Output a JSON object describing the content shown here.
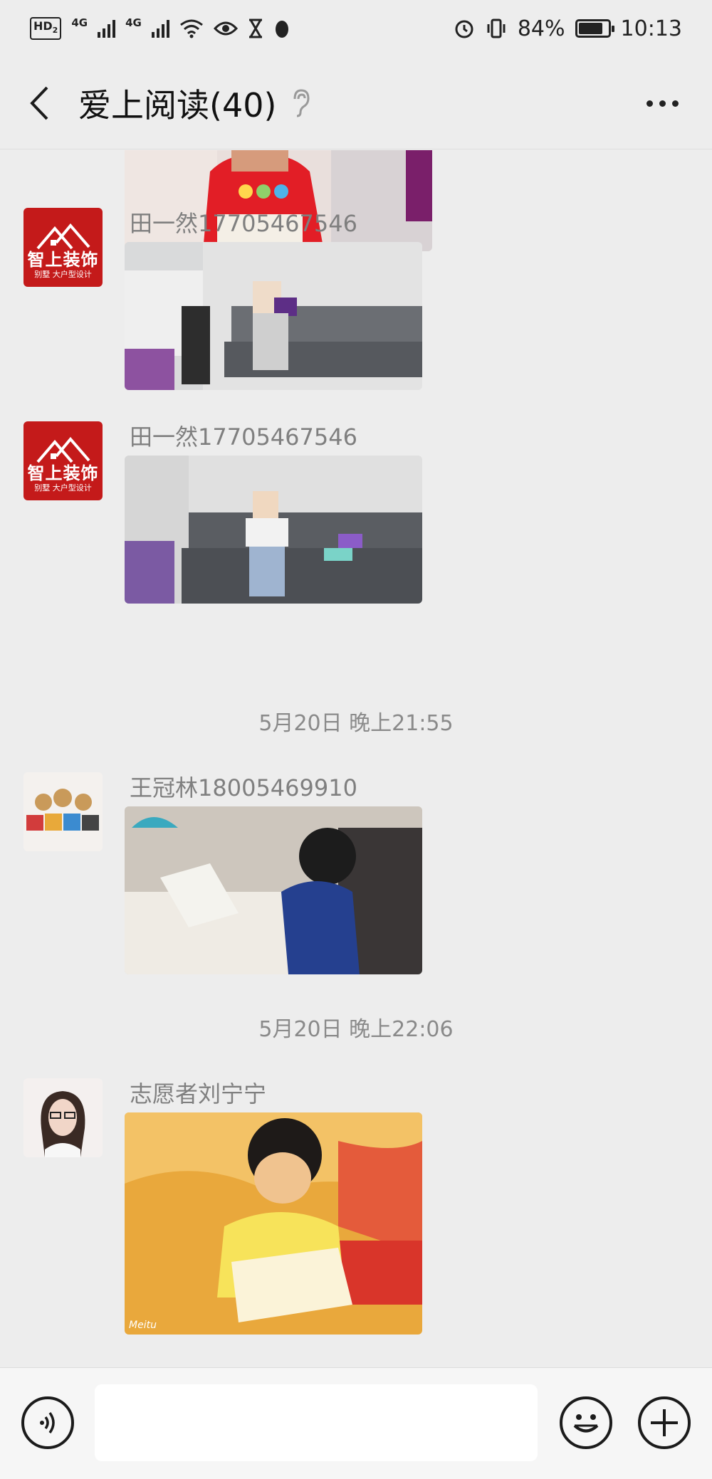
{
  "status_bar": {
    "hd_label": "HD",
    "hd_sub": "2",
    "net1": "4G",
    "net2": "4G",
    "battery_percent": "84%",
    "battery_level": 0.84,
    "time": "10:13"
  },
  "header": {
    "title": "爱上阅读(40)",
    "back_icon": "chevron-left-icon",
    "mute_icon": "ear-icon",
    "more_icon": "more-dots-icon"
  },
  "messages": [
    {
      "sender": "田一然17705467546",
      "avatar_brand": "智上装饰",
      "avatar_sub": "别墅 大户型设计"
    },
    {
      "sender": "田一然17705467546",
      "avatar_brand": "智上装饰",
      "avatar_sub": "别墅 大户型设计"
    },
    {
      "timestamp": "5月20日 晚上21:55"
    },
    {
      "sender": "王冠林18005469910"
    },
    {
      "timestamp": "5月20日 晚上22:06"
    },
    {
      "sender": "志愿者刘宁宁"
    }
  ],
  "photo_watermark": "Meitu",
  "input_bar": {
    "text_value": "",
    "voice_icon": "voice-icon",
    "emoji_icon": "emoji-icon",
    "plus_icon": "plus-circle-icon"
  }
}
